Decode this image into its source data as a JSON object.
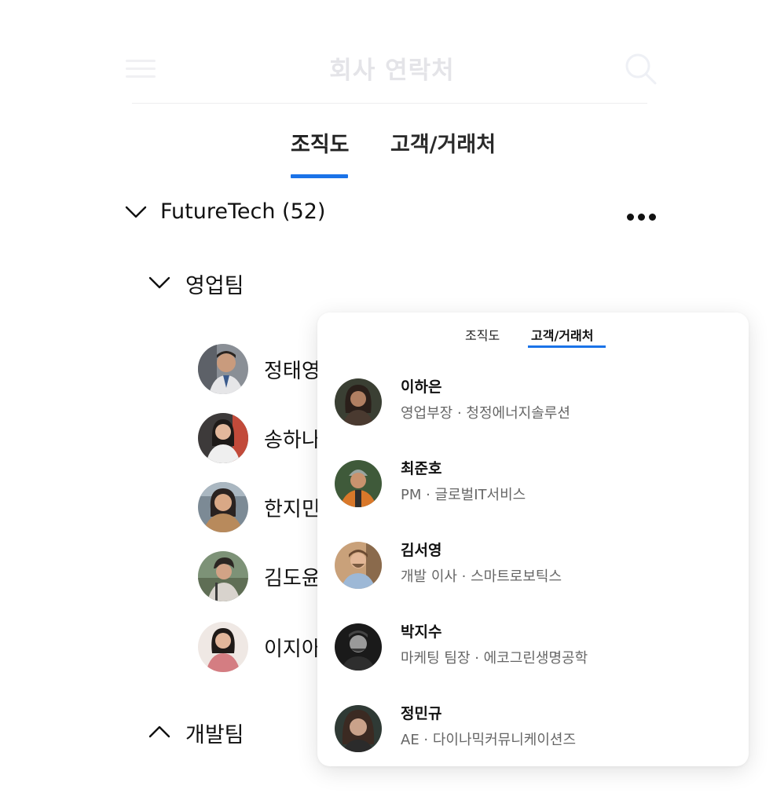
{
  "header": {
    "title": "회사 연락처"
  },
  "tabs": [
    {
      "label": "조직도"
    },
    {
      "label": "고객/거래처"
    }
  ],
  "org": {
    "name": "FutureTech (52)",
    "teams": [
      {
        "name": "영업팀",
        "members": [
          {
            "name": "정태영"
          },
          {
            "name": "송하나"
          },
          {
            "name": "한지민"
          },
          {
            "name": "김도윤"
          },
          {
            "name": "이지아"
          }
        ]
      },
      {
        "name": "개발팀"
      }
    ]
  },
  "popup": {
    "tabs": [
      {
        "label": "조직도"
      },
      {
        "label": "고객/거래처"
      }
    ],
    "contacts": [
      {
        "name": "이하은",
        "info": "영업부장 · 청정에너지솔루션"
      },
      {
        "name": "최준호",
        "info": "PM · 글로벌IT서비스"
      },
      {
        "name": "김서영",
        "info": "개발 이사 · 스마트로보틱스"
      },
      {
        "name": "박지수",
        "info": "마케팅 팀장 · 에코그린생명공학"
      },
      {
        "name": "정민규",
        "info": "AE · 다이나믹커뮤니케이션즈"
      }
    ]
  },
  "colors": {
    "accent": "#1a73e8"
  }
}
